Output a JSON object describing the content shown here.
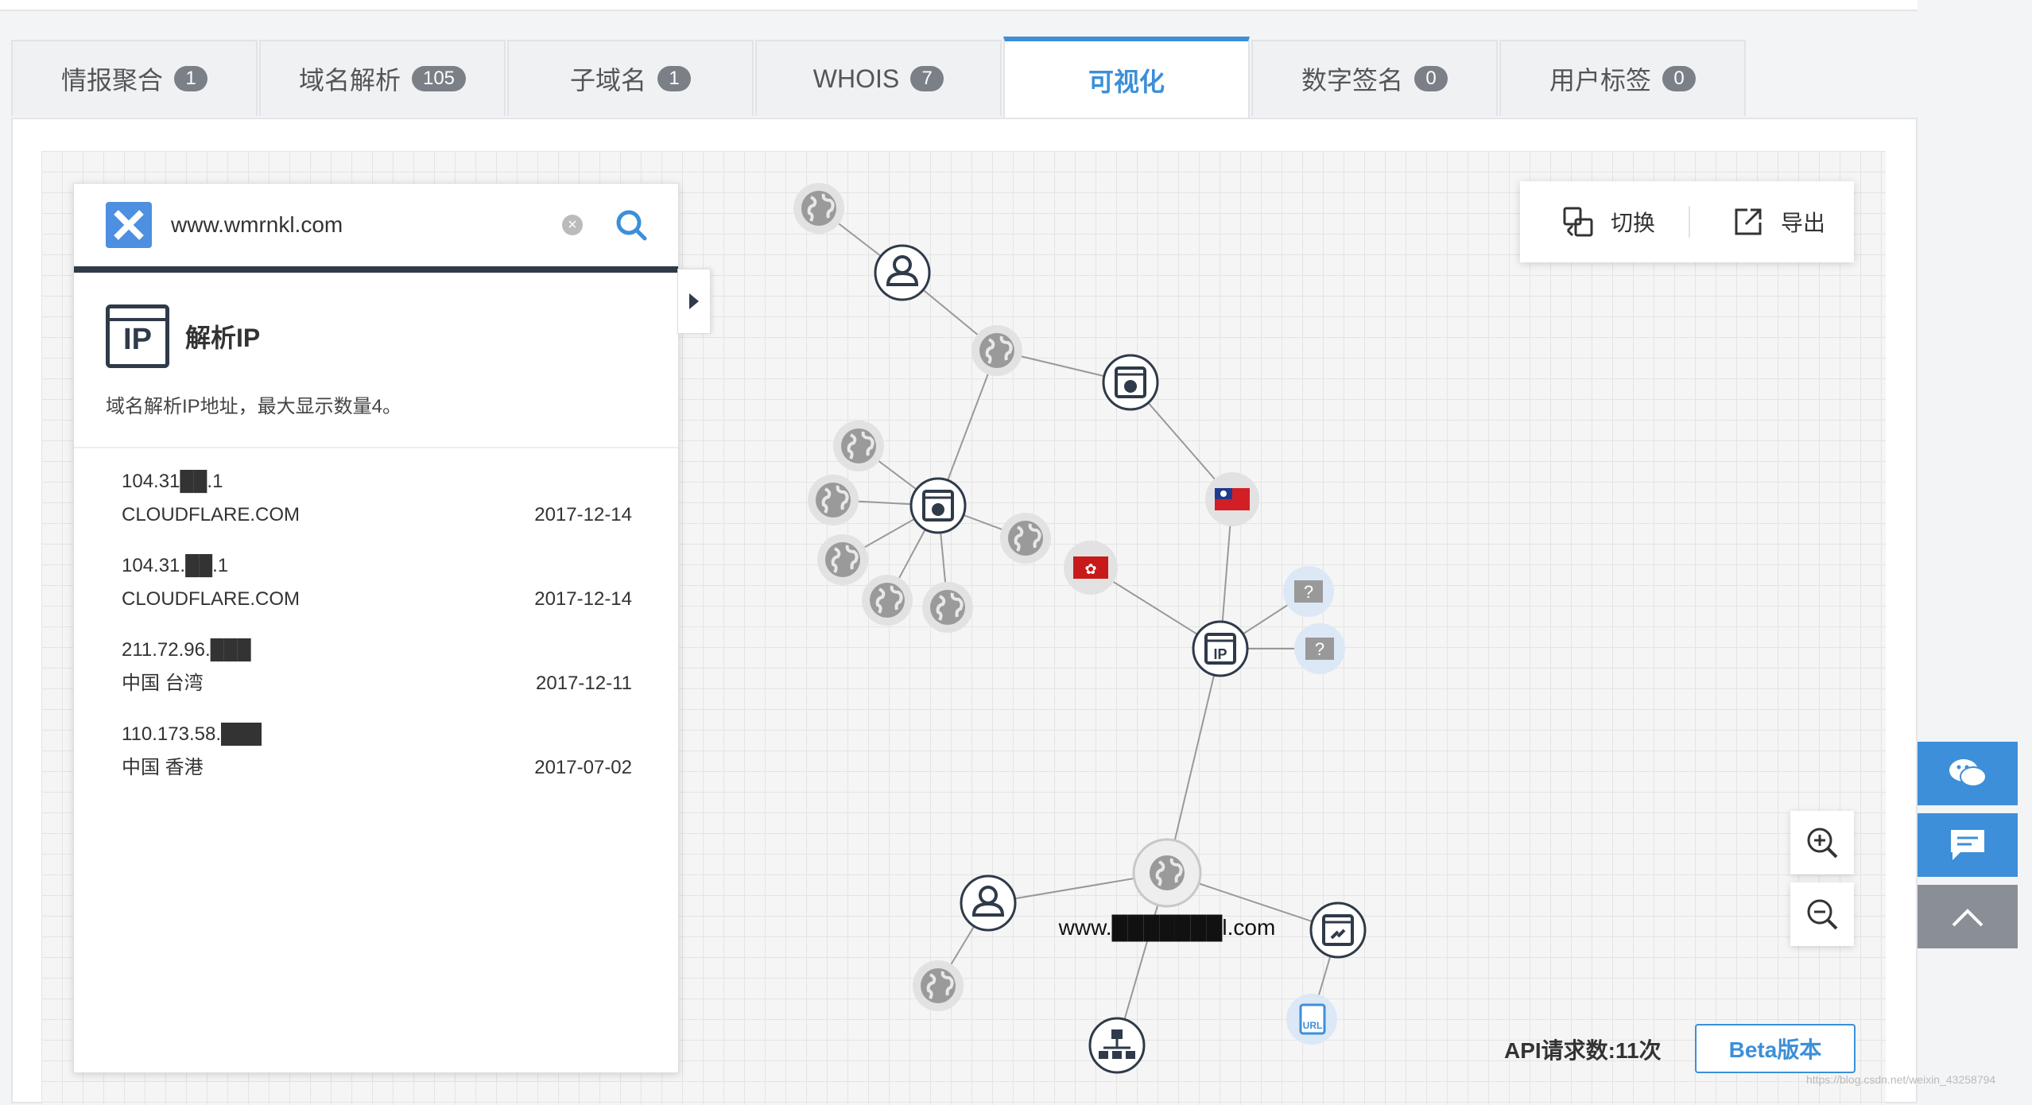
{
  "tabs": [
    {
      "label": "情报聚合",
      "count": "1"
    },
    {
      "label": "域名解析",
      "count": "105"
    },
    {
      "label": "子域名",
      "count": "1"
    },
    {
      "label": "WHOIS",
      "count": "7"
    },
    {
      "label": "可视化",
      "count": ""
    },
    {
      "label": "数字签名",
      "count": "0"
    },
    {
      "label": "用户标签",
      "count": "0"
    }
  ],
  "active_tab": "可视化",
  "search": {
    "value": "www.wmrnkl.com"
  },
  "section": {
    "title": "解析IP",
    "icon_text": "IP",
    "description": "域名解析IP地址，最大显示数量4。"
  },
  "records": [
    {
      "ip": "104.31██.1",
      "org": "CLOUDFLARE.COM",
      "date": "2017-12-14"
    },
    {
      "ip": "104.31.██.1",
      "org": "CLOUDFLARE.COM",
      "date": "2017-12-14"
    },
    {
      "ip": "211.72.96.███",
      "org": "中国 台湾",
      "date": "2017-12-11"
    },
    {
      "ip": "110.173.58.███",
      "org": "中国 香港",
      "date": "2017-07-02"
    }
  ],
  "toolbar": {
    "switch_label": "切换",
    "export_label": "导出"
  },
  "graph": {
    "center_label": "www.███████l.com",
    "unknown_label": "?",
    "url_label": "URL"
  },
  "footer": {
    "api_label": "API请求数:11次",
    "beta_label": "Beta版本"
  },
  "watermark": "https://blog.csdn.net/weixin_43258794",
  "colors": {
    "accent": "#3c8fd8",
    "node_dark": "#2f3a4a",
    "side_btn": "#3c8fd8",
    "side_btn_gray": "#8a8f96"
  }
}
